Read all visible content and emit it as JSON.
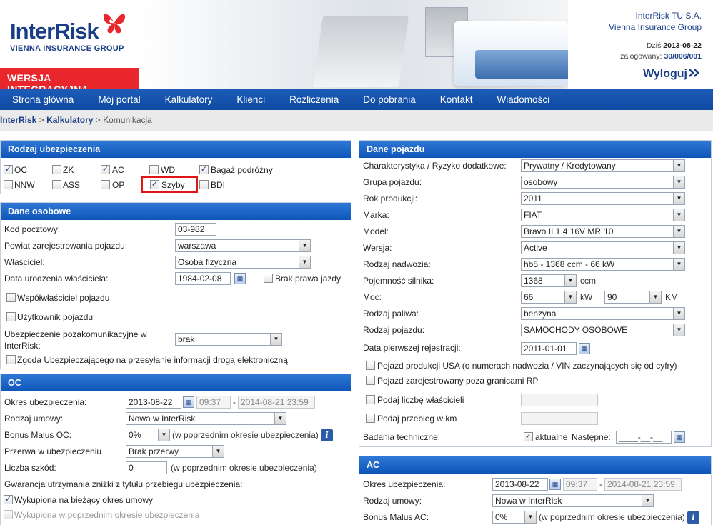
{
  "header": {
    "logo_text": "InterRisk",
    "logo_sub": "VIENNA INSURANCE GROUP",
    "version_badge": "WERSJA INTEGRACYJNA",
    "company_name": "InterRisk TU S.A.",
    "company_group": "Vienna Insurance Group",
    "today_label": "Dziś",
    "today_date": "2013-08-22",
    "logged_label": "zalogowany:",
    "login_id": "30/006/001",
    "logout": "Wyloguj",
    "logout_icon": "double-chevron-right",
    "colors": {
      "brand": "#1a3e86",
      "accent": "#e8262b"
    }
  },
  "nav": [
    "Strona główna",
    "Mój portal",
    "Kalkulatory",
    "Klienci",
    "Rozliczenia",
    "Do pobrania",
    "Kontakt",
    "Wiadomości"
  ],
  "breadcrumb": {
    "home": "InterRisk",
    "sep": ">",
    "calculators": "Kalkulatory",
    "current": "Komunikacja"
  },
  "rodzaj": {
    "title": "Rodzaj ubezpieczenia",
    "items": [
      {
        "label": "OC",
        "checked": true
      },
      {
        "label": "ZK",
        "checked": false
      },
      {
        "label": "AC",
        "checked": true
      },
      {
        "label": "WD",
        "checked": false
      },
      {
        "label": "Bagaż podróżny",
        "checked": true
      },
      {
        "label": "NNW",
        "checked": false
      },
      {
        "label": "ASS",
        "checked": false
      },
      {
        "label": "OP",
        "checked": false
      },
      {
        "label": "Szyby",
        "checked": true
      },
      {
        "label": "BDI",
        "checked": false
      }
    ]
  },
  "osobowe": {
    "title": "Dane osobowe",
    "kod_label": "Kod pocztowy:",
    "kod_value": "03-982",
    "powiat_label": "Powiat zarejestrowania pojazdu:",
    "powiat_value": "warszawa",
    "wlasciciel_label": "Właściciel:",
    "wlasciciel_value": "Osoba fizyczna",
    "data_label": "Data urodzenia właściciela:",
    "data_value": "1984-02-08",
    "brak_prawa": "Brak prawa jazdy",
    "wspolw": "Współwłaściciel pojazdu",
    "uzytk": "Użytkownik pojazdu",
    "pozakom_label1": "Ubezpieczenie pozakomunikacyjne w",
    "pozakom_label2": "InterRisk:",
    "pozakom_value": "brak",
    "zgoda": "Zgoda Ubezpieczającego na przesyłanie informacji drogą elektroniczną"
  },
  "oc": {
    "title": "OC",
    "okres_label": "Okres ubezpieczenia:",
    "okres_from": "2013-08-22",
    "okres_time": "09:37",
    "okres_dash": "-",
    "okres_to": "2014-08-21 23:59",
    "rodzaj_label": "Rodzaj umowy:",
    "rodzaj_value": "Nowa w InterRisk",
    "bonus_label": "Bonus Malus OC:",
    "bonus_value": "0%",
    "bonus_note": "(w poprzednim okresie ubezpieczenia)",
    "przerwa_label": "Przerwa w ubezpieczeniu",
    "przerwa_value": "Brak przerwy",
    "szkody_label": "Liczba szkód:",
    "szkody_value": "0",
    "szkody_note": "(w poprzednim okresie ubezpieczenia)",
    "gwar_label": "Gwarancja utrzymania zniżki z tytułu przebiegu ubezpieczenia:",
    "wyk_biez": "Wykupiona na bieżący okres umowy",
    "wyk_pop": "Wykupiona w poprzednim okresie ubezpieczenia"
  },
  "pojazd": {
    "title": "Dane pojazdu",
    "char_label": "Charakterystyka / Ryzyko dodatkowe:",
    "char_value": "Prywatny / Kredytowany",
    "grupa_label": "Grupa pojazdu:",
    "grupa_value": "osobowy",
    "rok_label": "Rok produkcji:",
    "rok_value": "2011",
    "marka_label": "Marka:",
    "marka_value": "FIAT",
    "model_label": "Model:",
    "model_value": "Bravo II 1.4 16V MR`10",
    "wersja_label": "Wersja:",
    "wersja_value": "Active",
    "nadwozie_label": "Rodzaj nadwozia:",
    "nadwozie_value": "hb5 - 1368 ccm - 66 kW",
    "poj_label": "Pojemność silnika:",
    "poj_value": "1368",
    "poj_unit": "ccm",
    "moc_label": "Moc:",
    "moc_kw": "66",
    "moc_kw_unit": "kW",
    "moc_km": "90",
    "moc_km_unit": "KM",
    "paliwo_label": "Rodzaj paliwa:",
    "paliwo_value": "benzyna",
    "rodzaj_label": "Rodzaj pojazdu:",
    "rodzaj_value": "SAMOCHODY OSOBOWE",
    "data_rej_label": "Data pierwszej rejestracji:",
    "data_rej_value": "2011-01-01",
    "usa": "Pojazd produkcji USA (o numerach nadwozia / VIN zaczynających się od cyfry)",
    "poza": "Pojazd zarejestrowany poza granicami RP",
    "wlasc": "Podaj liczbę właścicieli",
    "przebieg": "Podaj przebieg w km",
    "badania_label": "Badania techniczne:",
    "badania_cb": "aktualne",
    "nastepne_label": "Następne:",
    "nastepne_value": "____-__-__"
  },
  "ac": {
    "title": "AC",
    "okres_label": "Okres ubezpieczenia:",
    "okres_from": "2013-08-22",
    "okres_time": "09:37",
    "okres_dash": "-",
    "okres_to": "2014-08-21 23:59",
    "rodzaj_label": "Rodzaj umowy:",
    "rodzaj_value": "Nowa w InterRisk",
    "bonus_label": "Bonus Malus AC:",
    "bonus_value": "0%",
    "bonus_note": "(w poprzednim okresie ubezpieczenia)"
  },
  "icons": {
    "checkmark": "✓",
    "dropdown": "▼",
    "calendar": "▦",
    "info": "i"
  }
}
